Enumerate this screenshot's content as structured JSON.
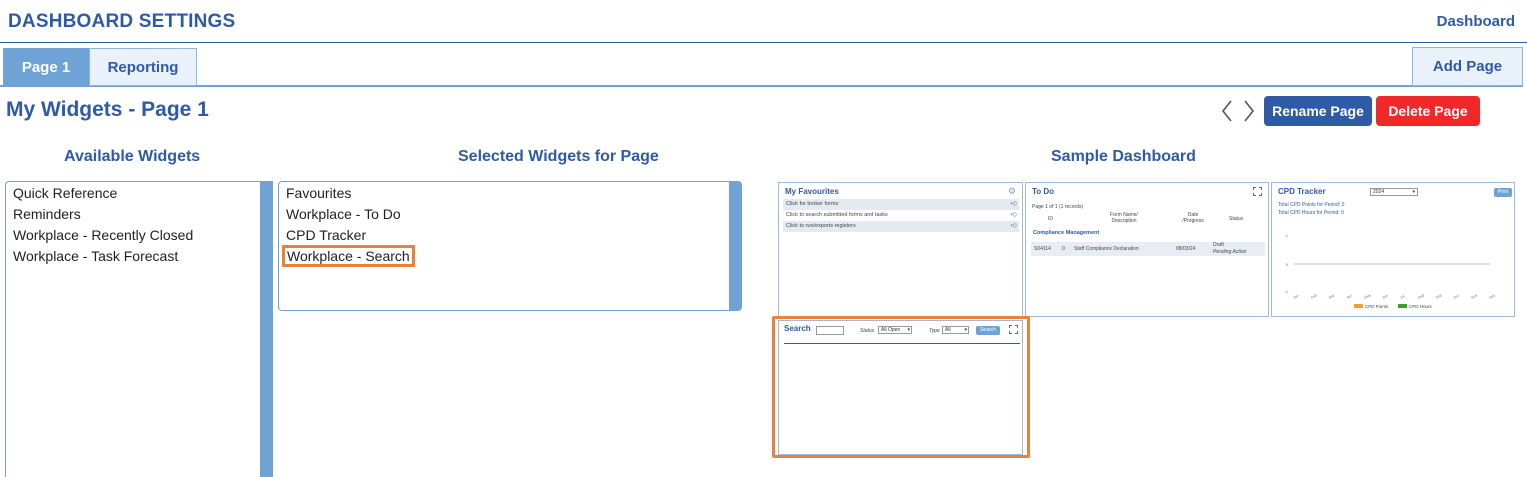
{
  "header": {
    "title": "DASHBOARD SETTINGS",
    "dashboard_link": "Dashboard"
  },
  "tabs": [
    {
      "label": "Page 1",
      "active": true
    },
    {
      "label": "Reporting",
      "active": false
    }
  ],
  "add_page_label": "Add Page",
  "page_heading": "My Widgets - Page 1",
  "nav": {
    "prev": "‹",
    "next": "›"
  },
  "buttons": {
    "rename": "Rename Page",
    "delete": "Delete Page"
  },
  "colors": {
    "brand": "#2f5aa8",
    "accent_light": "#6fa3d6",
    "danger": "#f0282a",
    "highlight": "#e9803c"
  },
  "available": {
    "title": "Available Widgets",
    "items": [
      "Quick Reference",
      "Reminders",
      "Workplace - Recently Closed",
      "Workplace - Task Forecast"
    ]
  },
  "selected": {
    "title": "Selected Widgets for Page",
    "items": [
      "Favourites",
      "Workplace - To Do",
      "CPD Tracker",
      "Workplace - Search"
    ],
    "highlighted_index": 3
  },
  "sample": {
    "title": "Sample Dashboard",
    "favourites": {
      "title": "My Favourites",
      "rows": [
        "Click for broker forms",
        "Click to search submitted forms and tasks",
        "Click to run/exports registers"
      ]
    },
    "todo": {
      "title": "To Do",
      "paging": "Page 1 of 1 (1 records)",
      "headers": [
        "ID",
        "Form Name/ Description",
        "Date /Progress",
        "Status"
      ],
      "group": "Compliance Management",
      "row": {
        "id": "S04114",
        "count": "0",
        "name": "Staff Compliance Declaration",
        "date": "08/03/24",
        "status": "Draft",
        "sub_status": "Pending Action"
      }
    },
    "cpd": {
      "title": "CPD Tracker",
      "year": "2024",
      "print": "Print",
      "points_label": "Total CPD Points for Period: 0",
      "hours_label": "Total CPD Hours for Period: 0",
      "y_ticks": [
        "1",
        "0",
        "-1"
      ],
      "months": [
        "Jan",
        "Feb",
        "Mar",
        "Apr",
        "May",
        "Jun",
        "Jul",
        "Aug",
        "Sep",
        "Oct",
        "Nov",
        "Dec"
      ],
      "legend": [
        "CPD Points",
        "CPD Hours"
      ]
    },
    "search": {
      "title": "Search",
      "status_label": "Status",
      "status_value": "All Open",
      "type_label": "Type",
      "type_value": "All",
      "button": "Search"
    }
  }
}
